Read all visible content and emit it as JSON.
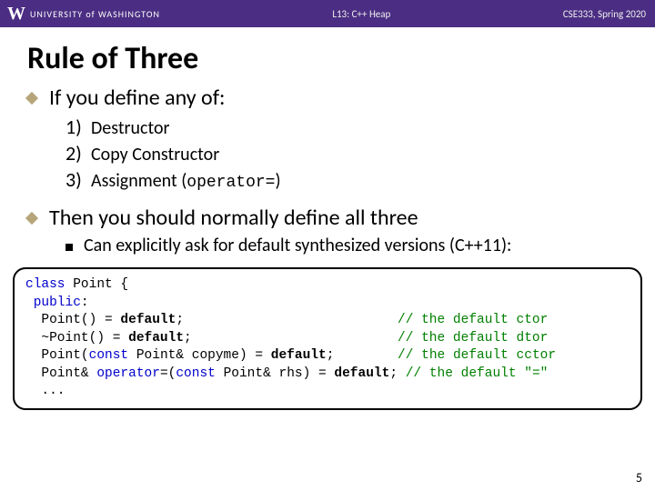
{
  "header": {
    "logo_w": "W",
    "logo_text": "UNIVERSITY of WASHINGTON",
    "center": "L13:  C++ Heap",
    "right": "CSE333, Spring 2020"
  },
  "title": "Rule of Three",
  "b1": {
    "text": "If you define any of:"
  },
  "list": {
    "n1": "1)",
    "i1": "Destructor",
    "n2": "2)",
    "i2": "Copy Constructor",
    "n3": "3)",
    "i3_a": "Assignment (",
    "i3_code": "operator=",
    "i3_b": ")"
  },
  "b2": {
    "text": "Then you should normally define all three"
  },
  "sub": {
    "text": "Can explicitly ask for default synthesized versions (C++11):"
  },
  "code": {
    "l1a": "class",
    "l1b": " Point {",
    "l2": "public",
    "l3a": "  Point() = ",
    "l3b": "default",
    "l3c": ";",
    "l4a": "  ~Point() = ",
    "l4b": "default",
    "l4c": ";",
    "l5a": "  Point(",
    "l5b": "const",
    "l5c": " Point& copyme) = ",
    "l5d": "default",
    "l5e": ";",
    "l6a": "  Point& ",
    "l6op": "operator",
    "l6b": "=(",
    "l6c": "const",
    "l6d": " Point& rhs) = ",
    "l6e": "default",
    "l6f": ";",
    "c3": "// the default ctor",
    "c4": "// the default dtor",
    "c5": "// the default cctor",
    "c6": "// the default \"=\"",
    "l7": "  ..."
  },
  "page": "5"
}
